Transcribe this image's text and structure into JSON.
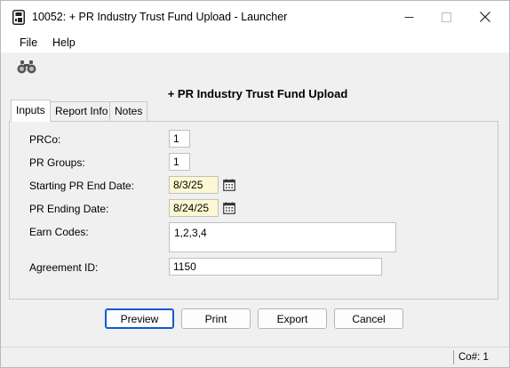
{
  "window": {
    "title": "10052: + PR Industry Trust Fund Upload - Launcher"
  },
  "icons": {
    "app": "document-app-icon",
    "minimize": "minimize-icon",
    "maximize": "maximize-icon",
    "close": "close-icon",
    "find": "binoculars-icon",
    "calendar": "calendar-icon"
  },
  "menu": {
    "file": "File",
    "help": "Help"
  },
  "form": {
    "title": "+ PR Industry Trust Fund Upload"
  },
  "tabs": [
    {
      "label": "Inputs",
      "active": true
    },
    {
      "label": "Report Info",
      "active": false
    },
    {
      "label": "Notes",
      "active": false
    }
  ],
  "fields": {
    "prco": {
      "label": "PRCo:",
      "value": "1"
    },
    "pr_groups": {
      "label": "PR Groups:",
      "value": "1"
    },
    "start_date": {
      "label": "Starting PR End Date:",
      "value": "8/3/25"
    },
    "end_date": {
      "label": "PR Ending Date:",
      "value": "8/24/25"
    },
    "earn_codes": {
      "label": "Earn Codes:",
      "value": "1,2,3,4"
    },
    "agreement_id": {
      "label": "Agreement ID:",
      "value": "1150"
    }
  },
  "buttons": {
    "preview": "Preview",
    "print": "Print",
    "export": "Export",
    "cancel": "Cancel"
  },
  "status": {
    "company": "Co#: 1"
  },
  "colors": {
    "date_field_bg": "#fdf8d4",
    "default_button_border": "#0a5ad2"
  }
}
